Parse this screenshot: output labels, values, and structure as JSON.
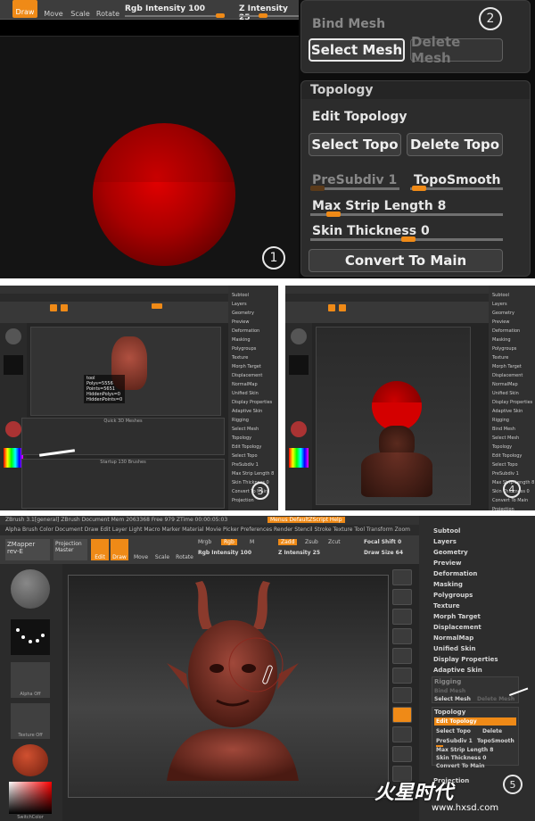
{
  "panel1": {
    "toolbar": {
      "draw": "Draw",
      "move": "Move",
      "scale": "Scale",
      "rotate": "Rotate",
      "rgb_label": "Rgb Intensity 100",
      "z_label": "Z Intensity 25"
    },
    "step": "1"
  },
  "panel2": {
    "rigging": {
      "bind_mesh": "Bind Mesh",
      "select_mesh": "Select Mesh",
      "delete_mesh": "Delete Mesh"
    },
    "topology": {
      "title": "Topology",
      "edit_topology": "Edit Topology",
      "select_topo": "Select Topo",
      "delete_topo": "Delete Topo",
      "presubdiv": "PreSubdiv 1",
      "toposmooth": "TopoSmooth",
      "max_strip": "Max Strip Length 8",
      "skin_thickness": "Skin Thickness 0",
      "convert": "Convert To Main"
    },
    "step": "2"
  },
  "panel3": {
    "info": [
      "tool",
      "Polys=5556",
      "Points=5651",
      "HiddenPolys=0",
      "HiddenPoints=0"
    ],
    "right_items": [
      "Subtool",
      "Layers",
      "Geometry",
      "Preview",
      "Deformation",
      "Masking",
      "Polygroups",
      "Texture",
      "Morph Target",
      "Displacement",
      "NormalMap",
      "Unified Skin",
      "Display Properties",
      "Adaptive Skin",
      "Rigging",
      "Select Mesh",
      "Topology",
      "Edit Topology",
      "Select Topo",
      "PreSubdiv 1",
      "Max Strip Length 8",
      "Skin Thickness 0",
      "Convert To Main",
      "Projection"
    ],
    "step": "3",
    "quick_label": "Quick 3D Meshes",
    "brushes_label": "Startup 130 Brushes"
  },
  "panel4": {
    "right_items": [
      "Subtool",
      "Layers",
      "Geometry",
      "Preview",
      "Deformation",
      "Masking",
      "Polygroups",
      "Texture",
      "Morph Target",
      "Displacement",
      "NormalMap",
      "Unified Skin",
      "Display Properties",
      "Adaptive Skin",
      "Rigging",
      "Bind Mesh",
      "Select Mesh",
      "Topology",
      "Edit Topology",
      "Select Topo",
      "PreSubdiv 1",
      "Max Strip Length 8",
      "Skin Thickness 0",
      "Convert To Main",
      "Projection"
    ],
    "step": "4"
  },
  "panel5": {
    "title_bar": "ZBrush 3.1[general]   ZBrush Document   Mem 2063368 Free 979 ZTime 00:00:05:03",
    "menu": "Alpha  Brush  Color  Document  Draw  Edit  Layer  Light  Macro  Marker  Material  Movie  Picker  Preferences  Render  Stencil  Stroke  Texture  Tool  Transform  Zoom  Zplugin  Zscript",
    "script_badge": "Menus   DefaultZScript   Help",
    "toolbar": {
      "tool_label": "ZMapper rev-E",
      "projection": "Projection Master",
      "edit": "Edit",
      "draw": "Draw",
      "move": "Move",
      "scale": "Scale",
      "rotate": "Rotate",
      "mrgb": "Mrgb",
      "rgb": "Rgb",
      "rgb_intensity": "Rgb Intensity 100",
      "m": "M",
      "zadd": "Zadd",
      "zsub": "Zsub",
      "zcut": "Zcut",
      "z_intensity": "Z Intensity 25",
      "focal": "Focal Shift 0",
      "draw_size": "Draw Size 64"
    },
    "right": {
      "subtool": "Subtool",
      "layers": "Layers",
      "geometry": "Geometry",
      "preview": "Preview",
      "deformation": "Deformation",
      "masking": "Masking",
      "polygroups": "Polygroups",
      "texture": "Texture",
      "morph": "Morph Target",
      "displacement": "Displacement",
      "normalmap": "NormalMap",
      "unified": "Unified Skin",
      "display": "Display Properties",
      "adaptive": "Adaptive Skin",
      "rigging": "Rigging",
      "bind_mesh": "Bind Mesh",
      "select_mesh": "Select Mesh",
      "delete_mesh": "Delete Mesh",
      "topology": "Topology",
      "edit_topology": "Edit Topology",
      "select_topo": "Select Topo",
      "delete_topo": "Delete",
      "presubdiv": "PreSubdiv 1",
      "toposmooth": "TopoSmooth",
      "max_strip": "Max Strip Length 8",
      "skin": "Skin Thickness 0",
      "convert": "Convert To Main",
      "projection": "Projection"
    },
    "left": {
      "alpha_off": "Alpha Off",
      "texture_off": "Texture Off",
      "color_label": "SwitchColor"
    },
    "step": "5"
  },
  "watermark": {
    "brand": "火星时代",
    "url": "www.hxsd.com"
  }
}
